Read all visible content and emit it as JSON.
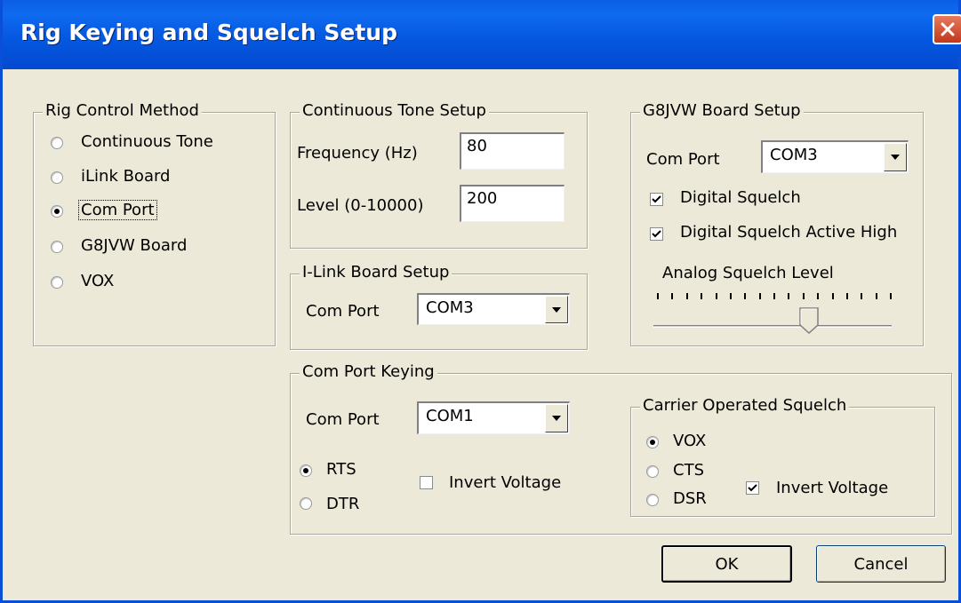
{
  "window": {
    "title": "Rig Keying and Squelch Setup",
    "close_icon": "close-icon"
  },
  "rig_control": {
    "title": "Rig Control Method",
    "options": [
      "Continuous Tone",
      "iLink Board",
      "Com Port",
      "G8JVW Board",
      "VOX"
    ],
    "selected": "Com Port"
  },
  "continuous_tone": {
    "title": "Continuous Tone Setup",
    "frequency_label": "Frequency (Hz)",
    "frequency_value": "80",
    "level_label": "Level (0-10000)",
    "level_value": "200"
  },
  "ilink": {
    "title": "I-Link Board Setup",
    "com_port_label": "Com Port",
    "com_port_value": "COM3"
  },
  "g8jvw": {
    "title": "G8JVW Board Setup",
    "com_port_label": "Com Port",
    "com_port_value": "COM3",
    "digital_squelch_label": "Digital Squelch",
    "digital_squelch_checked": true,
    "active_high_label": "Digital Squelch Active High",
    "active_high_checked": true,
    "analog_label": "Analog Squelch Level",
    "analog_level_fraction": 0.65
  },
  "com_port_keying": {
    "title": "Com Port Keying",
    "com_port_label": "Com Port",
    "com_port_value": "COM1",
    "rts_label": "RTS",
    "dtr_label": "DTR",
    "selected": "RTS",
    "invert_label": "Invert Voltage",
    "invert_checked": false
  },
  "cos": {
    "title": "Carrier Operated Squelch",
    "vox_label": "VOX",
    "cts_label": "CTS",
    "dsr_label": "DSR",
    "selected": "VOX",
    "invert_label": "Invert Voltage",
    "invert_checked": true
  },
  "buttons": {
    "ok_label": "OK",
    "cancel_label": "Cancel"
  }
}
